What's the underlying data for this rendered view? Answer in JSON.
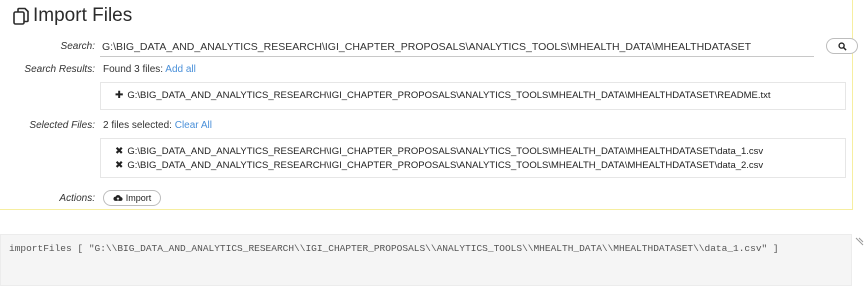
{
  "title": {
    "text": "Import Files",
    "icon": "files-icon"
  },
  "search": {
    "label": "Search:",
    "value": "G:\\BIG_DATA_AND_ANALYTICS_RESEARCH\\IGI_CHAPTER_PROPOSALS\\ANALYTICS_TOOLS\\MHEALTH_DATA\\MHEALTHDATASET",
    "button_icon": "search-icon"
  },
  "search_results": {
    "label": "Search Results:",
    "summary": "Found 3 files:",
    "action_link": "Add all",
    "items": [
      {
        "path": "G:\\BIG_DATA_AND_ANALYTICS_RESEARCH\\IGI_CHAPTER_PROPOSALS\\ANALYTICS_TOOLS\\MHEALTH_DATA\\MHEALTHDATASET\\README.txt",
        "icon": "plus-icon"
      }
    ]
  },
  "selected_files": {
    "label": "Selected Files:",
    "summary": "2 files selected:",
    "action_link": "Clear All",
    "items": [
      {
        "path": "G:\\BIG_DATA_AND_ANALYTICS_RESEARCH\\IGI_CHAPTER_PROPOSALS\\ANALYTICS_TOOLS\\MHEALTH_DATA\\MHEALTHDATASET\\data_1.csv",
        "icon": "remove-icon"
      },
      {
        "path": "G:\\BIG_DATA_AND_ANALYTICS_RESEARCH\\IGI_CHAPTER_PROPOSALS\\ANALYTICS_TOOLS\\MHEALTH_DATA\\MHEALTHDATASET\\data_2.csv",
        "icon": "remove-icon"
      }
    ]
  },
  "actions": {
    "label": "Actions:",
    "import_label": "Import",
    "import_icon": "upload-cloud-icon"
  },
  "output": {
    "text": "importFiles [ \"G:\\\\BIG_DATA_AND_ANALYTICS_RESEARCH\\\\IGI_CHAPTER_PROPOSALS\\\\ANALYTICS_TOOLS\\\\MHEALTH_DATA\\\\MHEALTHDATASET\\\\data_1.csv\" ]"
  },
  "colors": {
    "link": "#4a90d9",
    "panel_border": "#f6eea0",
    "output_bg": "#f5f5f5"
  }
}
